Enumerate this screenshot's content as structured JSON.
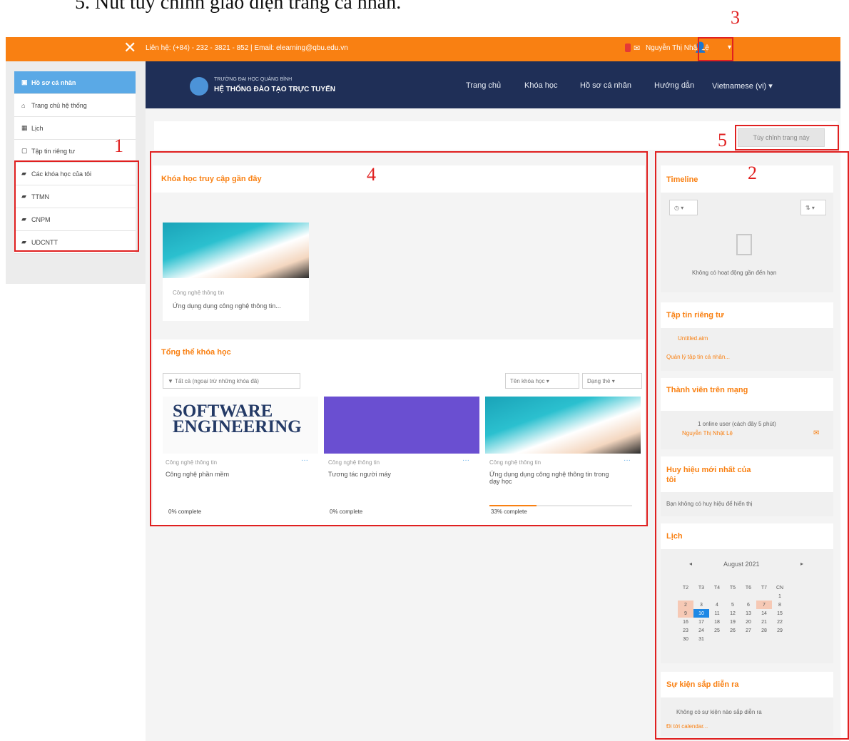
{
  "caption": "5. Nút tùy chỉnh giao diện trang cá nhân.",
  "topbar": {
    "close_icon": "✕",
    "contact": "Liên hệ: (+84) - 232 - 3821 - 852 | Email: elearning@qbu.edu.vn",
    "user_name": "Nguyễn Thị Nhật Lệ",
    "bell_icon": "bell-icon",
    "chat_icon": "chat-icon",
    "user_icon": "user-icon"
  },
  "left_menu": [
    {
      "label": "Hồ sơ cá nhân",
      "icon": "▣",
      "active": true
    },
    {
      "label": "Trang chủ hệ thống",
      "icon": "⌂",
      "active": false
    },
    {
      "label": "Lịch",
      "icon": "▦",
      "active": false
    },
    {
      "label": "Tập tin riêng tư",
      "icon": "▢",
      "active": false
    },
    {
      "label": "Các khóa học của tôi",
      "icon": "▰",
      "active": false
    },
    {
      "label": "TTMN",
      "icon": "▰",
      "active": false
    },
    {
      "label": "CNPM",
      "icon": "▰",
      "active": false
    },
    {
      "label": "UDCNTT",
      "icon": "▰",
      "active": false
    }
  ],
  "navbar": {
    "logo_sub": "TRƯỜNG ĐẠI HỌC QUẢNG BÌNH",
    "logo_main": "HỆ THỐNG ĐÀO TẠO TRỰC TUYẾN",
    "links": [
      "Trang chủ",
      "Khóa học",
      "Hồ sơ cá nhân",
      "Hướng dẫn",
      "Vietnamese (vi) ▾"
    ]
  },
  "customize_button": "Tùy chỉnh trang này",
  "recent": {
    "title": "Khóa học truy cập gần đây",
    "course_category": "Công nghệ thông tin",
    "course_name": "Ứng dụng dụng công nghệ thông tin..."
  },
  "overview": {
    "title": "Tổng thể khóa học",
    "filter": "▼ Tất cả (ngoại trừ những khóa đã)",
    "sort": "Tên khóa học ▾",
    "view": "Dạng thẻ ▾",
    "courses": [
      {
        "category": "Công nghệ thông tin",
        "name": "Công nghệ phần mềm",
        "progress": "0% complete",
        "progress_value": 0,
        "image": "SOFTWARE ENGINEERING"
      },
      {
        "category": "Công nghệ thông tin",
        "name": "Tương tác người máy",
        "progress": "0% complete",
        "progress_value": 0,
        "image": ""
      },
      {
        "category": "Công nghệ thông tin",
        "name": "Ứng dụng dụng công nghệ thông tin trong dạy học",
        "progress": "33% complete",
        "progress_value": 33,
        "image": ""
      }
    ],
    "dots": "···"
  },
  "timeline": {
    "title": "Timeline",
    "empty": "Không có hoạt động gần đến hạn"
  },
  "private_files": {
    "title": "Tập tin riêng tư",
    "file": "Untitled.aim",
    "manage": "Quản lý tập tin cá nhân..."
  },
  "online_users": {
    "title": "Thành viên trên mạng",
    "summary": "1 online user (cách đây 5 phút)",
    "user": "Nguyễn Thị Nhật Lệ"
  },
  "badges": {
    "title": "Huy hiệu mới nhất của tôi",
    "empty": "Bạn không có huy hiệu để hiển thị"
  },
  "calendar": {
    "title": "Lịch",
    "month": "August 2021",
    "prev": "◂",
    "next": "▸",
    "weekdays": [
      "T2",
      "T3",
      "T4",
      "T5",
      "T6",
      "T7",
      "CN"
    ],
    "weeks": [
      [
        "",
        "",
        "",
        "",
        "",
        "",
        "1"
      ],
      [
        "2",
        "3",
        "4",
        "5",
        "6",
        "7",
        "8"
      ],
      [
        "9",
        "10",
        "11",
        "12",
        "13",
        "14",
        "15"
      ],
      [
        "16",
        "17",
        "18",
        "19",
        "20",
        "21",
        "22"
      ],
      [
        "23",
        "24",
        "25",
        "26",
        "27",
        "28",
        "29"
      ],
      [
        "30",
        "31",
        "",
        "",
        "",
        "",
        ""
      ]
    ]
  },
  "upcoming": {
    "title": "Sự kiện sắp diễn ra",
    "empty": "Không có sự kiện nào sắp diễn ra",
    "link": "Đi tới calendar..."
  },
  "annotations": [
    "1",
    "2",
    "3",
    "4",
    "5"
  ]
}
